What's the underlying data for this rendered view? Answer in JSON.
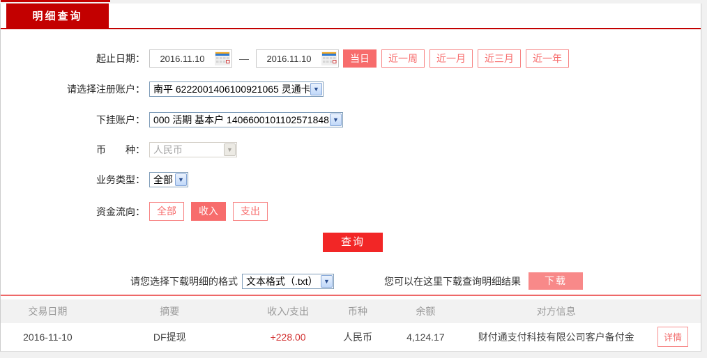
{
  "tab": {
    "label": "明细查询"
  },
  "form": {
    "date_range": {
      "label": "起止日期：",
      "start": "2016.11.10",
      "end": "2016.11.10",
      "separator": "—",
      "quick_buttons": [
        {
          "label": "当日",
          "active": true
        },
        {
          "label": "近一周",
          "active": false
        },
        {
          "label": "近一月",
          "active": false
        },
        {
          "label": "近三月",
          "active": false
        },
        {
          "label": "近一年",
          "active": false
        }
      ]
    },
    "register_account": {
      "label": "请选择注册账户：",
      "value": "南平 6222001406100921065 灵通卡"
    },
    "sub_account": {
      "label": "下挂账户：",
      "value": "000 活期 基本户 1406600101102571848"
    },
    "currency": {
      "label": "币　　种：",
      "value": "人民币",
      "disabled": true
    },
    "business_type": {
      "label": "业务类型：",
      "value": "全部"
    },
    "fund_flow": {
      "label": "资金流向：",
      "options": [
        {
          "label": "全部",
          "active": false
        },
        {
          "label": "收入",
          "active": true
        },
        {
          "label": "支出",
          "active": false
        }
      ]
    },
    "query_button": "查询"
  },
  "download": {
    "format_label": "请您选择下载明细的格式",
    "format_value": "文本格式（.txt）",
    "hint": "您可以在这里下载查询明细结果",
    "button": "下载"
  },
  "table": {
    "headers": [
      "交易日期",
      "摘要",
      "收入/支出",
      "币种",
      "余额",
      "对方信息"
    ],
    "rows": [
      {
        "date": "2016-11-10",
        "summary": "DF提现",
        "amount": "+228.00",
        "currency": "人民币",
        "balance": "4,124.17",
        "counterparty": "财付通支付科技有限公司客户备付金",
        "detail_button": "详情"
      }
    ]
  },
  "colors": {
    "brand_red": "#c30000",
    "query_red": "#f22626",
    "salmon": "#f76c6c",
    "amount_red": "#d23030",
    "header_grey": "#f2f2f2"
  }
}
